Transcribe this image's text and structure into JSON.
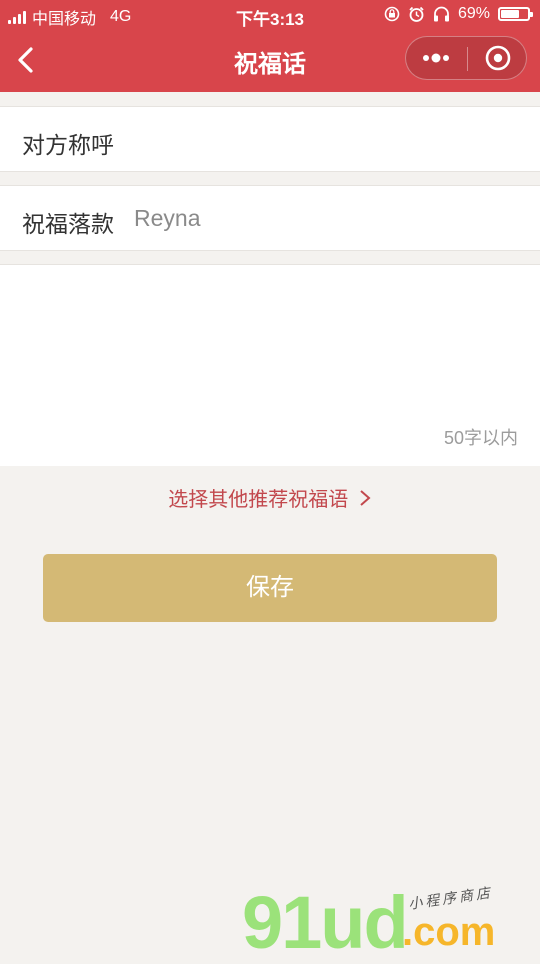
{
  "status_bar": {
    "carrier": "中国移动",
    "network": "4G",
    "time": "下午3:13",
    "battery_percent": "69%",
    "battery_level": 0.69
  },
  "nav": {
    "title": "祝福话",
    "back_icon": "chevron-left-icon",
    "more_icon": "more-dots-icon",
    "close_icon": "target-circle-icon"
  },
  "form": {
    "recipient_label": "对方称呼",
    "sign_label": "祝福落款",
    "sign_value": "Reyna",
    "message_hint": "50字以内"
  },
  "link_text": "选择其他推荐祝福语",
  "save_label": "保存",
  "watermark": {
    "main": "91ud",
    "com": ".com",
    "sub": "小程序商店"
  },
  "colors": {
    "header": "#d8454b",
    "save_button": "#d4b975",
    "link": "#c2484d",
    "background": "#f4f2ef"
  }
}
